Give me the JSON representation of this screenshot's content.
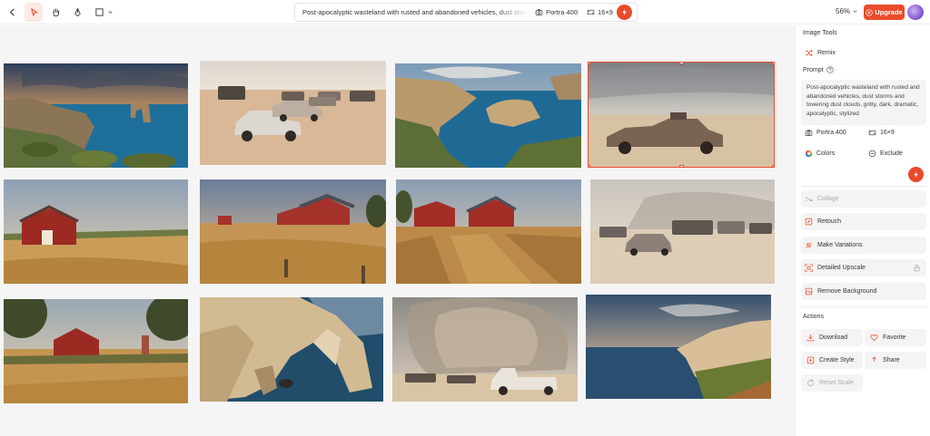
{
  "toolbar": {
    "prompt_preview": "Post-apocalyptic wasteland with rusted and abandoned vehicles, dust storms an",
    "film": "Portra 400",
    "ratio": "16×9",
    "zoom": "56%",
    "upgrade_label": "Upgrade"
  },
  "sidebar": {
    "image_tools_title": "Image Tools",
    "remix_label": "Remix",
    "prompt_label": "Prompt",
    "prompt_text": "Post-apocalyptic wasteland with rusted and abandoned vehicles, dust storms and towering dust clouds, gritty, dark, dramatic, apocalyptic, stylized",
    "film": "Portra 400",
    "ratio": "16×9",
    "colors_label": "Colors",
    "exclude_label": "Exclude",
    "tools": [
      "Collage",
      "Retouch",
      "Make Variations",
      "Detailed Upscale",
      "Remove Background"
    ],
    "actions_title": "Actions",
    "actions": [
      "Download",
      "Favorite",
      "Create Style",
      "Share",
      "Reset Scale"
    ]
  },
  "colors": {
    "accent": "#ea4b2a",
    "selection": "#ea4b2a",
    "panel_bg": "#f4f4f4"
  },
  "icons": [
    "back-icon",
    "pointer-icon",
    "hand-icon",
    "pen-icon",
    "frame-icon",
    "camera-icon",
    "aspect-icon",
    "bolt-icon",
    "remix-icon",
    "help-icon",
    "palette-icon",
    "exclude-icon",
    "collage-icon",
    "retouch-icon",
    "variations-icon",
    "upscale-icon",
    "lock-icon",
    "remove-bg-icon",
    "download-icon",
    "heart-icon",
    "style-icon",
    "share-icon",
    "reset-icon"
  ]
}
